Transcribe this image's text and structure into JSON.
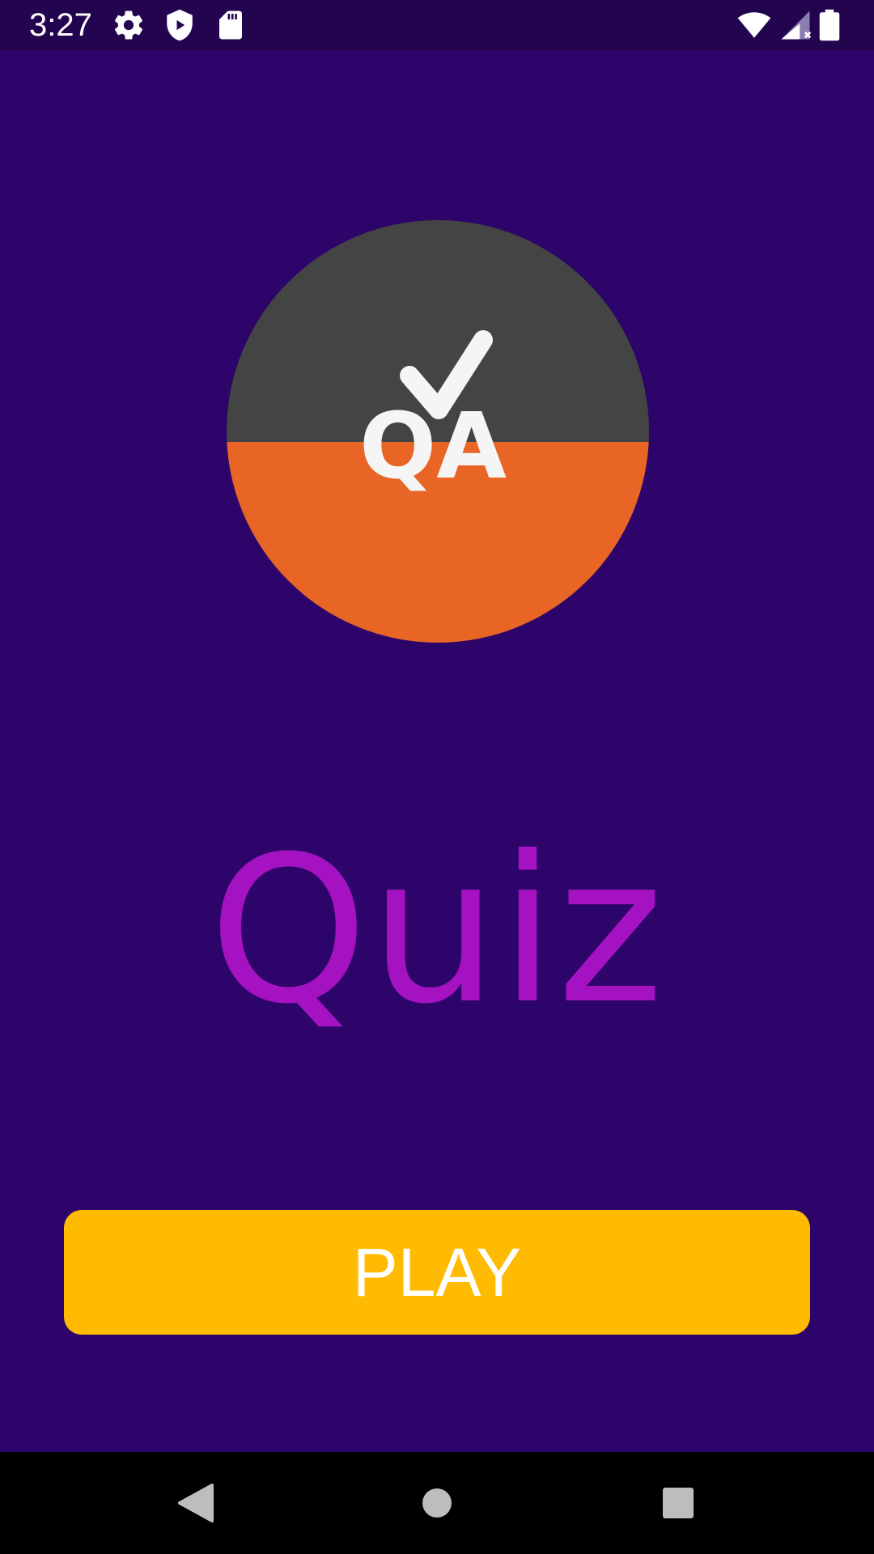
{
  "status_bar": {
    "time": "3:27",
    "icons": [
      "gear-icon",
      "shield-play-icon",
      "sd-card-icon",
      "wifi-icon",
      "cell-signal-no-data-icon",
      "battery-icon"
    ]
  },
  "logo": {
    "text": "QA",
    "icon": "checkmark-icon",
    "colors": {
      "top": "#444444",
      "bottom": "#e86526",
      "glyph": "#f5f5f5"
    }
  },
  "main": {
    "title": "Quiz",
    "play_label": "PLAY"
  },
  "nav_bar": {
    "icons": [
      "back-icon",
      "home-icon",
      "recents-icon"
    ]
  },
  "colors": {
    "background": "#2d0469",
    "status_bar": "#22044f",
    "title": "#a512c1",
    "button": "#ffbb01",
    "button_text": "#ffffff",
    "nav_bar": "#000000"
  }
}
